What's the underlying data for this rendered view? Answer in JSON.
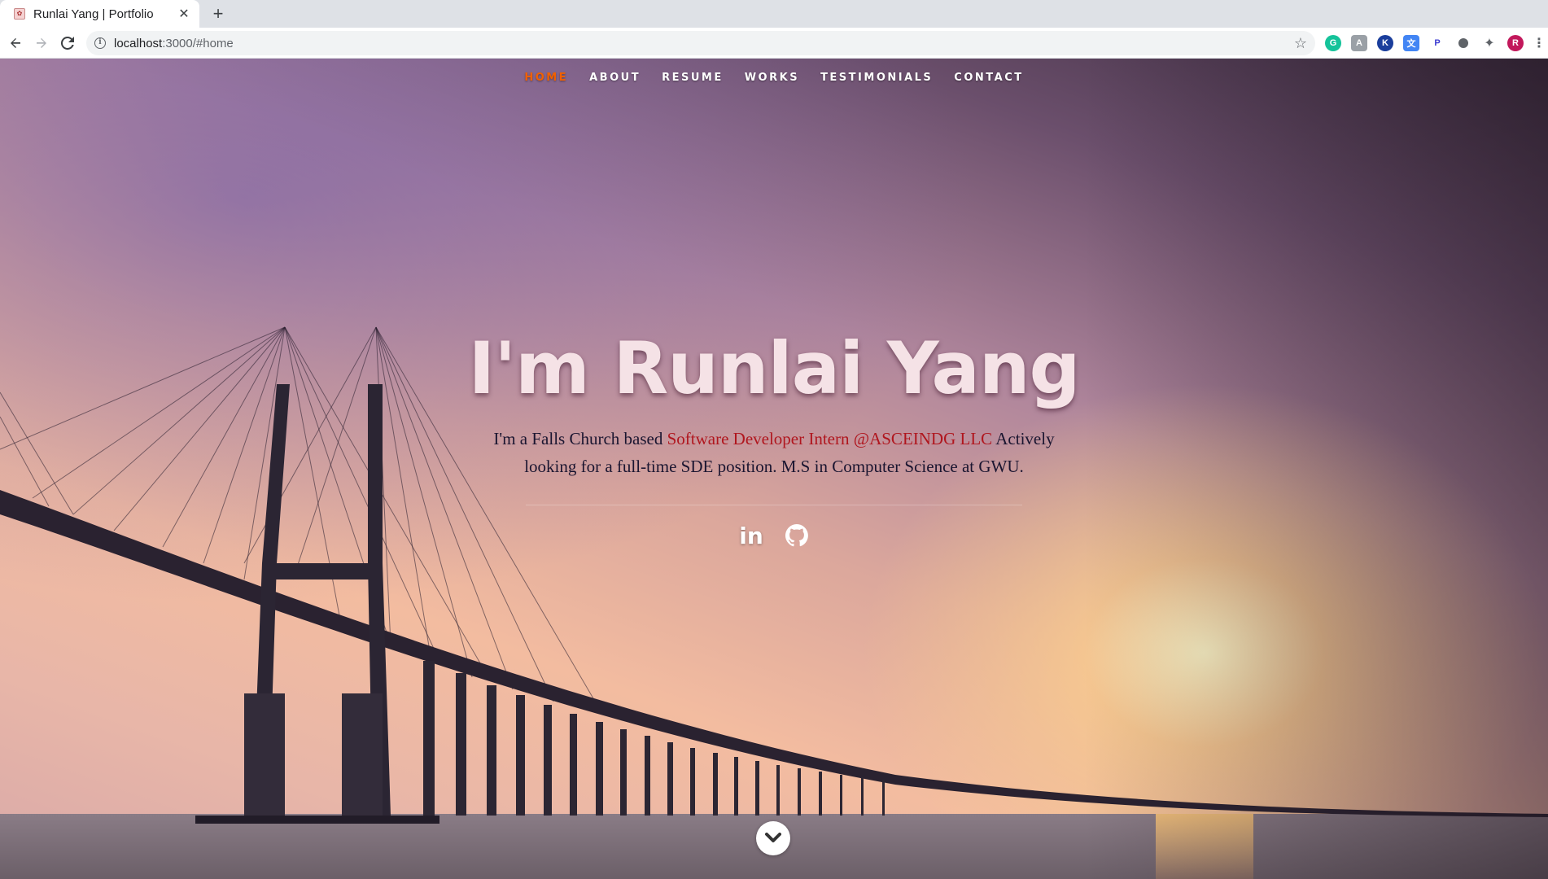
{
  "browser": {
    "tab_title": "Runlai Yang | Portfolio",
    "tab_close": "✕",
    "new_tab": "+",
    "url_host": "localhost",
    "url_path": ":3000/#home",
    "extensions": [
      "grammarly-icon",
      "extension-icon",
      "k-extension-icon",
      "translate-icon",
      "p-extension-icon",
      "circle-extension-icon",
      "puzzle-icon",
      "profile-avatar",
      "menu-icon"
    ],
    "profile_initial": "R"
  },
  "nav": {
    "items": [
      {
        "label": "HOME",
        "active": true
      },
      {
        "label": "ABOUT"
      },
      {
        "label": "RESUME"
      },
      {
        "label": "WORKS"
      },
      {
        "label": "TESTIMONIALS"
      },
      {
        "label": "CONTACT"
      }
    ]
  },
  "hero": {
    "title": "I'm Runlai Yang",
    "sub_prefix": "I'm a Falls Church based ",
    "sub_highlight": "Software Developer Intern @ASCEINDG LLC",
    "sub_suffix": " Actively looking for a full-time SDE position. M.S in Computer Science at GWU."
  },
  "social": {
    "linkedin": "in",
    "github": "github-icon"
  },
  "colors": {
    "nav_active": "#f06000",
    "highlight": "#b0161e"
  }
}
